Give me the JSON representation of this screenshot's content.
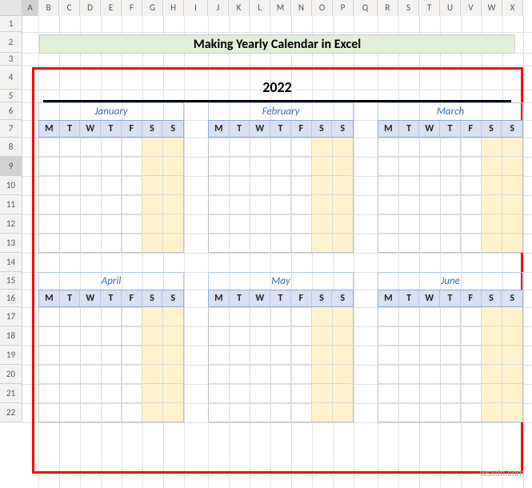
{
  "columns": [
    "A",
    "B",
    "C",
    "D",
    "E",
    "F",
    "G",
    "H",
    "I",
    "J",
    "K",
    "L",
    "M",
    "N",
    "O",
    "P",
    "Q",
    "R",
    "S",
    "T",
    "U",
    "V",
    "W",
    "X"
  ],
  "rows_shown": [
    "1",
    "2",
    "3",
    "4",
    "5",
    "6",
    "7",
    "8",
    "9",
    "10",
    "11",
    "12",
    "13",
    "14",
    "15",
    "16",
    "17",
    "18",
    "19",
    "20",
    "21",
    "22"
  ],
  "selected_row": "9",
  "selected_col": "A",
  "title": "Making Yearly Calendar in Excel",
  "year": "2022",
  "dow": [
    "M",
    "T",
    "W",
    "T",
    "F",
    "S",
    "S"
  ],
  "months_row1": [
    "January",
    "February",
    "March"
  ],
  "months_row2": [
    "April",
    "May",
    "June"
  ],
  "watermark": "wsxdn.com",
  "chart_data": {
    "type": "table",
    "title": "Making Yearly Calendar in Excel",
    "year": 2022,
    "months_visible": [
      "January",
      "February",
      "March",
      "April",
      "May",
      "June"
    ],
    "week_starts": "Monday",
    "layout": "3 columns x N month-rows, 6 week-rows per month",
    "weekend_columns": [
      "S",
      "S"
    ],
    "day_header": [
      "M",
      "T",
      "W",
      "T",
      "F",
      "S",
      "S"
    ],
    "cells_filled": false
  }
}
